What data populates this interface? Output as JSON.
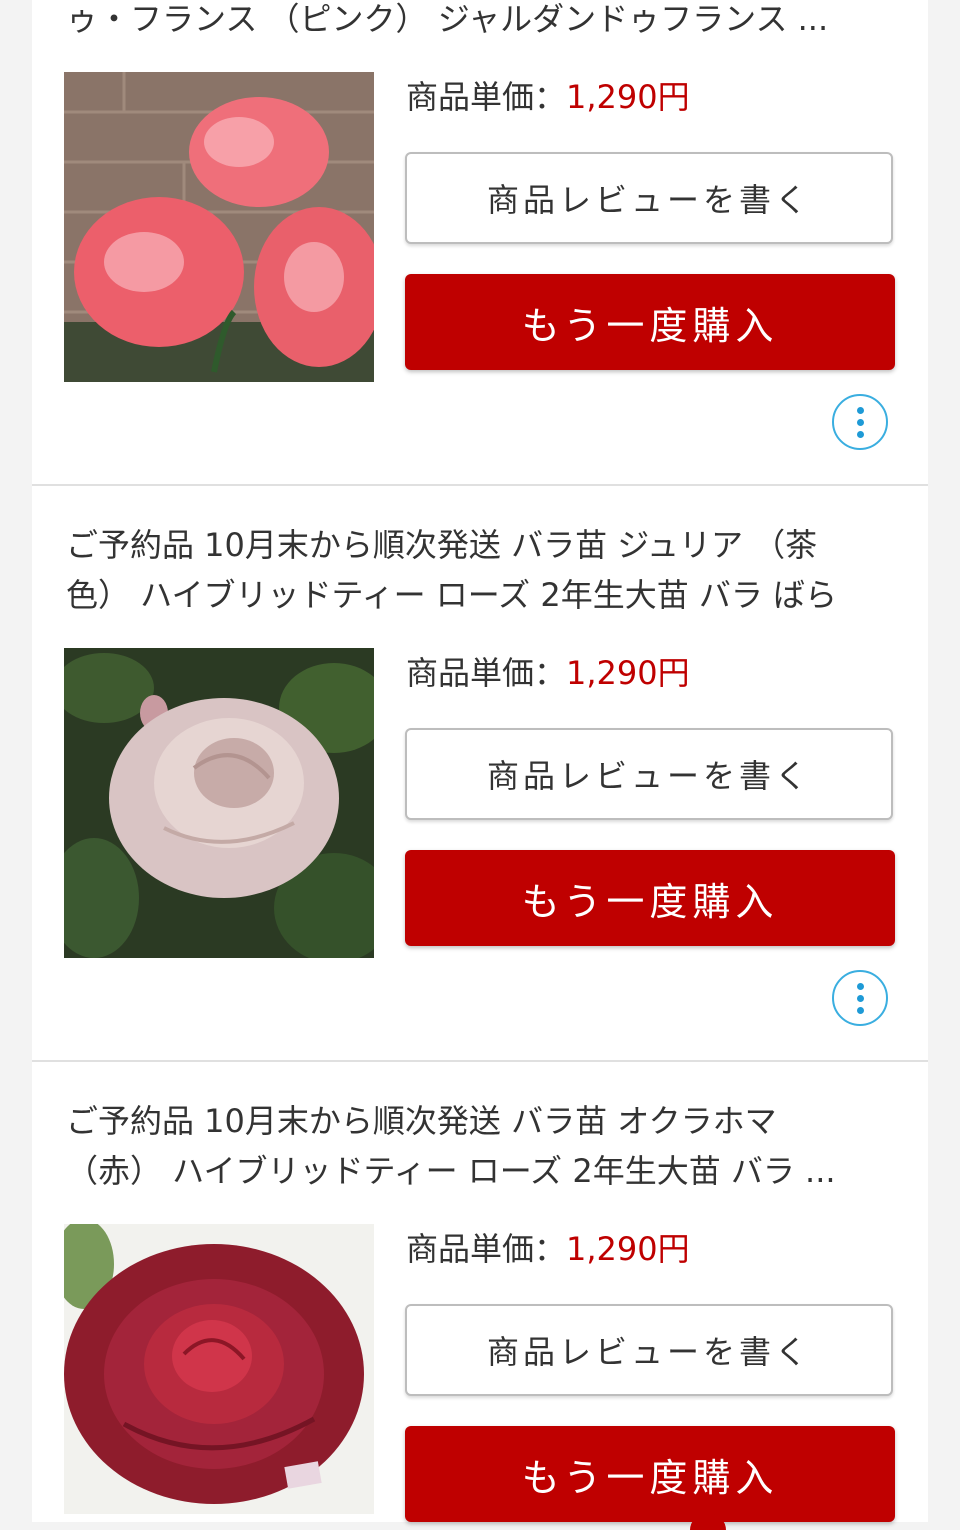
{
  "items": [
    {
      "title_lines": [
        "ゥ・フランス （ピンク） ジャルダンドゥフランス ..."
      ],
      "price_label": "商品単価：",
      "price_value": "1,290円",
      "review_label": "商品レビューを書く",
      "rebuy_label": "もう一度購入",
      "image_alt": "pink-rose-photo"
    },
    {
      "title_lines": [
        "ご予約品 10月末から順次発送 バラ苗 ジュリア （茶",
        "色） ハイブリッドティー ローズ 2年生大苗 バラ ばら"
      ],
      "price_label": "商品単価：",
      "price_value": "1,290円",
      "review_label": "商品レビューを書く",
      "rebuy_label": "もう一度購入",
      "image_alt": "brown-rose-photo"
    },
    {
      "title_lines": [
        "ご予約品 10月末から順次発送 バラ苗 オクラホマ",
        "（赤） ハイブリッドティー ローズ 2年生大苗 バラ ..."
      ],
      "price_label": "商品単価：",
      "price_value": "1,290円",
      "review_label": "商品レビューを書く",
      "rebuy_label": "もう一度購入",
      "image_alt": "red-rose-photo"
    }
  ],
  "colors": {
    "accent": "#bf0000",
    "more_icon": "#1e9ad6",
    "divider": "#e0e0e0"
  }
}
